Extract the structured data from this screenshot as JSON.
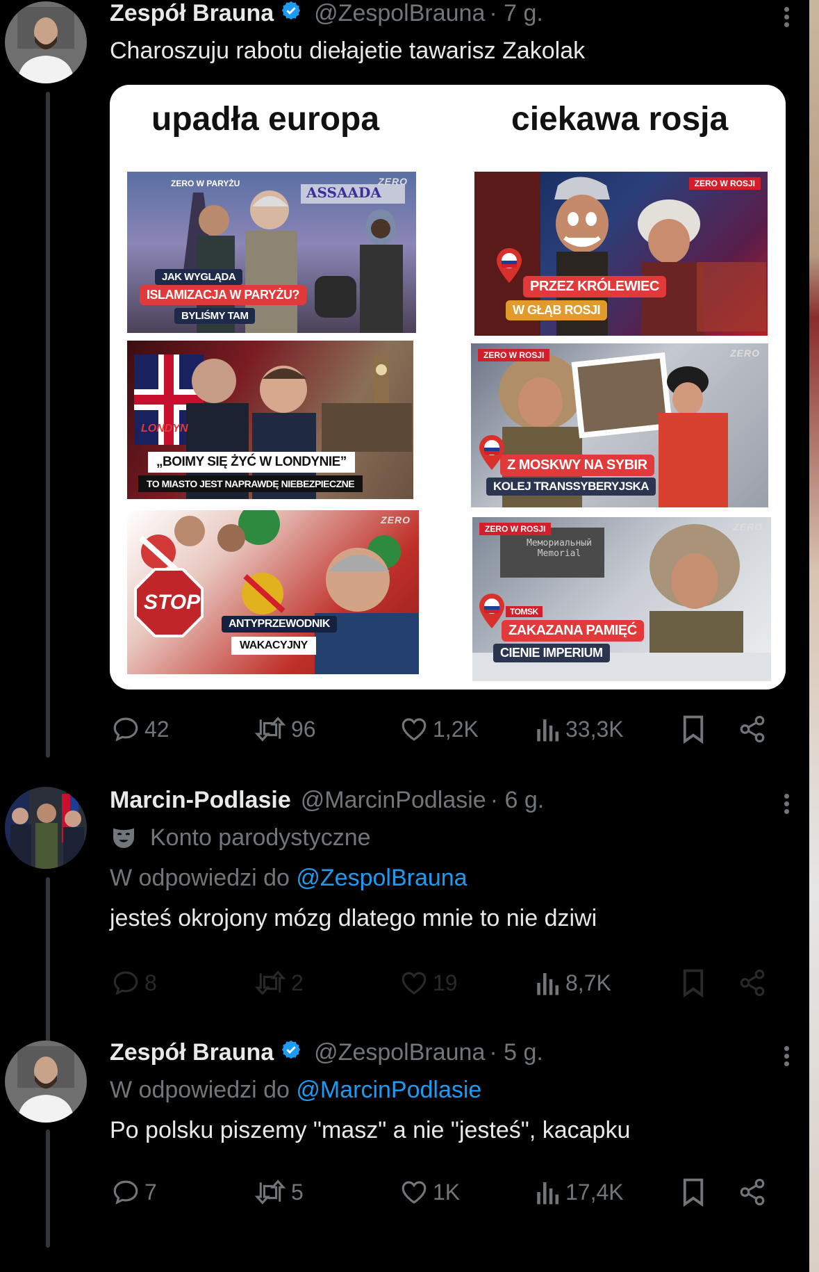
{
  "tweets": [
    {
      "name": "Zespół Brauna",
      "handle": "@ZespolBrauna",
      "time": "· 7 g.",
      "text": "Charoszuju rabotu diełajetie tawarisz Zakolak",
      "stats": {
        "replies": "42",
        "retweets": "96",
        "likes": "1,2K",
        "views": "33,3K"
      }
    },
    {
      "name": "Marcin-Podlasie",
      "handle": "@MarcinPodlasie",
      "time": "· 6 g.",
      "parody_label": "Konto parodystyczne",
      "reply_prefix": "W odpowiedzi do",
      "reply_to": "@ZespolBrauna",
      "text": "jesteś okrojony mózg dlatego mnie to nie dziwi",
      "stats": {
        "replies": "8",
        "retweets": "2",
        "likes": "19",
        "views": "8,7K"
      }
    },
    {
      "name": "Zespół Brauna",
      "handle": "@ZespolBrauna",
      "time": "· 5 g.",
      "reply_prefix": "W odpowiedzi do",
      "reply_to": "@MarcinPodlasie",
      "text": "Po polsku piszemy \"masz\" a nie \"jesteś\", kacapku",
      "stats": {
        "replies": "7",
        "retweets": "5",
        "likes": "1K",
        "views": "17,4K"
      }
    }
  ],
  "media": {
    "left_title": "upadła europa",
    "right_title": "ciekawa rosja",
    "brand": "ZERO",
    "left": [
      {
        "tag": "ZERO W PARYŻU",
        "sign": "ASSAADA",
        "cap1": "JAK WYGLĄDA",
        "cap2": "ISLAMIZACJA W PARYŻU?",
        "cap3": "BYLIŚMY TAM"
      },
      {
        "tag": "LONDYN",
        "cap1": "„BOIMY SIĘ ŻYĆ W LONDYNIE”",
        "cap2": "TO MIASTO JEST NAPRAWDĘ NIEBEZPIECZNE"
      },
      {
        "sign": "STOP",
        "cap1": "ANTYPRZEWODNIK",
        "cap2": "WAKACYJNY"
      }
    ],
    "right": [
      {
        "tag": "ZERO W ROSJI",
        "cap1": "PRZEZ KRÓLEWIEC",
        "cap2": "W GŁĄB ROSJI"
      },
      {
        "tag": "ZERO W ROSJI",
        "cap1": "Z MOSKWY NA SYBIR",
        "cap2": "KOLEJ TRANSSYBERYJSKA"
      },
      {
        "tag": "ZERO W ROSJI",
        "sign": "Мемориальный Memorial",
        "small": "TOMSK",
        "cap1": "ZAKAZANA PAMIĘĆ",
        "cap2": "CIENIE IMPERIUM"
      }
    ]
  },
  "colors": {
    "background": "#000000",
    "text": "#e7e9ea",
    "muted": "#71767b",
    "link": "#1d9bf0",
    "verified": "#1d9bf0"
  },
  "icons": [
    "reply-icon",
    "retweet-icon",
    "like-icon",
    "views-icon",
    "bookmark-icon",
    "share-icon",
    "verified-icon",
    "more-icon",
    "parody-mask-icon"
  ]
}
